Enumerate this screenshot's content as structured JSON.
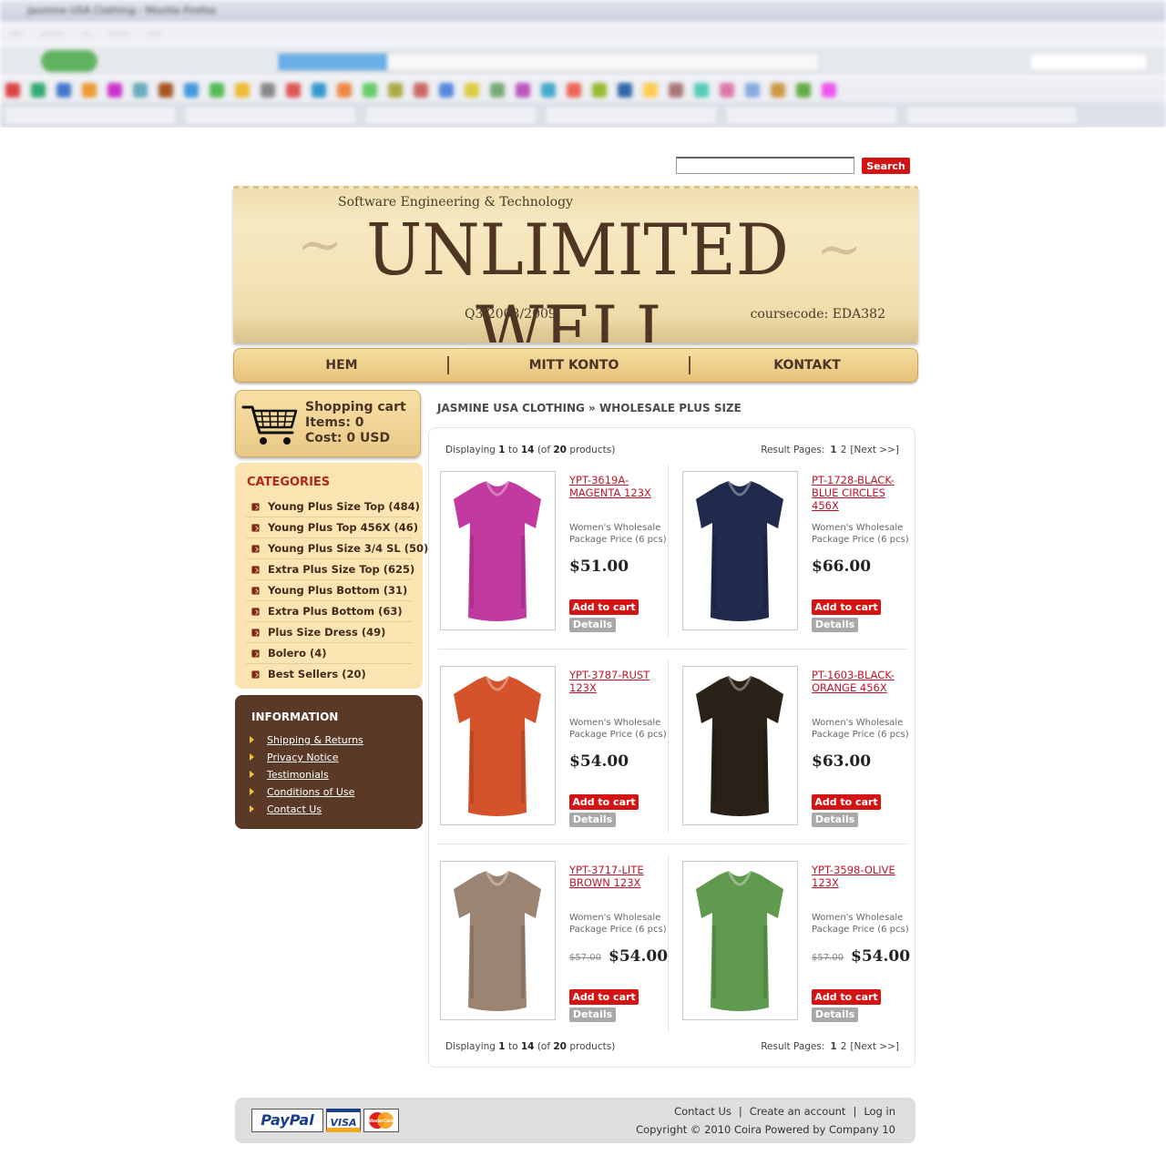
{
  "browser": {
    "window_title": "Jasmine USA Clothing - Mozilla Firefox"
  },
  "search": {
    "placeholder": "",
    "button_label": "Search"
  },
  "banner": {
    "subtitle": "Software Engineering & Technology",
    "title": "UNLIMITED WELL",
    "quarter": "Q3 2008/2009",
    "course_code": "coursecode: EDA382"
  },
  "nav": {
    "items": [
      {
        "label": "HEM"
      },
      {
        "label": "MITT KONTO"
      },
      {
        "label": "KONTAKT"
      }
    ]
  },
  "cart": {
    "title": "Shopping cart",
    "items": "Items: 0",
    "cost": "Cost: 0 USD"
  },
  "categories": {
    "title": "CATEGORIES",
    "items": [
      {
        "label": "Young Plus Size Top (484)"
      },
      {
        "label": "Young Plus Top 456X (46)"
      },
      {
        "label": "Young Plus Size 3/4 SL (50)"
      },
      {
        "label": "Extra Plus Size Top (625)"
      },
      {
        "label": "Young Plus Bottom (31)"
      },
      {
        "label": "Extra Plus Bottom (63)"
      },
      {
        "label": "Plus Size Dress (49)"
      },
      {
        "label": "Bolero (4)"
      },
      {
        "label": "Best Sellers (20)"
      }
    ]
  },
  "information": {
    "title": "INFORMATION",
    "links": [
      {
        "label": "Shipping & Returns"
      },
      {
        "label": "Privacy Notice"
      },
      {
        "label": "Testimonials"
      },
      {
        "label": "Conditions of Use"
      },
      {
        "label": "Contact Us"
      }
    ]
  },
  "breadcrumb": "JASMINE USA CLOTHING » WHOLESALE PLUS SIZE",
  "pager": {
    "displaying_prefix": "Displaying",
    "from": "1",
    "to_word": "to",
    "to": "14",
    "of_prefix": "(of",
    "total": "20",
    "of_suffix": "products)",
    "result_pages_label": "Result Pages:",
    "page1": "1",
    "page2": "2",
    "next": "[Next >>]"
  },
  "products": [
    {
      "name": "YPT-3619A-MAGENTA 123X",
      "desc": "Women's Wholesale Package Price (6 pcs)",
      "price": "$51.00",
      "old_price": "",
      "image": "magenta-top",
      "color": "#c23aa0"
    },
    {
      "name": "PT-1728-BLACK-BLUE CIRCLES 456X",
      "desc": "Women's Wholesale Package Price (6 pcs)",
      "price": "$66.00",
      "old_price": "",
      "image": "black-blue-circles-top",
      "color": "#1f2a4c"
    },
    {
      "name": "YPT-3787-RUST 123X",
      "desc": "Women's Wholesale Package Price (6 pcs)",
      "price": "$54.00",
      "old_price": "",
      "image": "rust-top",
      "color": "#d5532a"
    },
    {
      "name": "PT-1603-BLACK-ORANGE 456X",
      "desc": "Women's Wholesale Package Price (6 pcs)",
      "price": "$63.00",
      "old_price": "",
      "image": "black-orange-top",
      "color": "#2a2218"
    },
    {
      "name": "YPT-3717-LITE BROWN 123X",
      "desc": "Women's Wholesale Package Price (6 pcs)",
      "price": "$54.00",
      "old_price": "$57.00",
      "image": "lite-brown-top",
      "color": "#9c8472"
    },
    {
      "name": "YPT-3598-OLIVE 123X",
      "desc": "Women's Wholesale Package Price (6 pcs)",
      "price": "$54.00",
      "old_price": "$57.00",
      "image": "olive-top",
      "color": "#5f9a4e"
    }
  ],
  "product_buttons": {
    "add_to_cart": "Add to cart",
    "details": "Details"
  },
  "footer": {
    "payment": [
      "PayPal",
      "VISA",
      "MasterCard"
    ],
    "links": [
      {
        "label": "Contact Us"
      },
      {
        "label": "Create an account"
      },
      {
        "label": "Log in"
      }
    ],
    "link_separator": "|",
    "copyright": "Copyright © 2010 Coira Powered by Company 10"
  }
}
